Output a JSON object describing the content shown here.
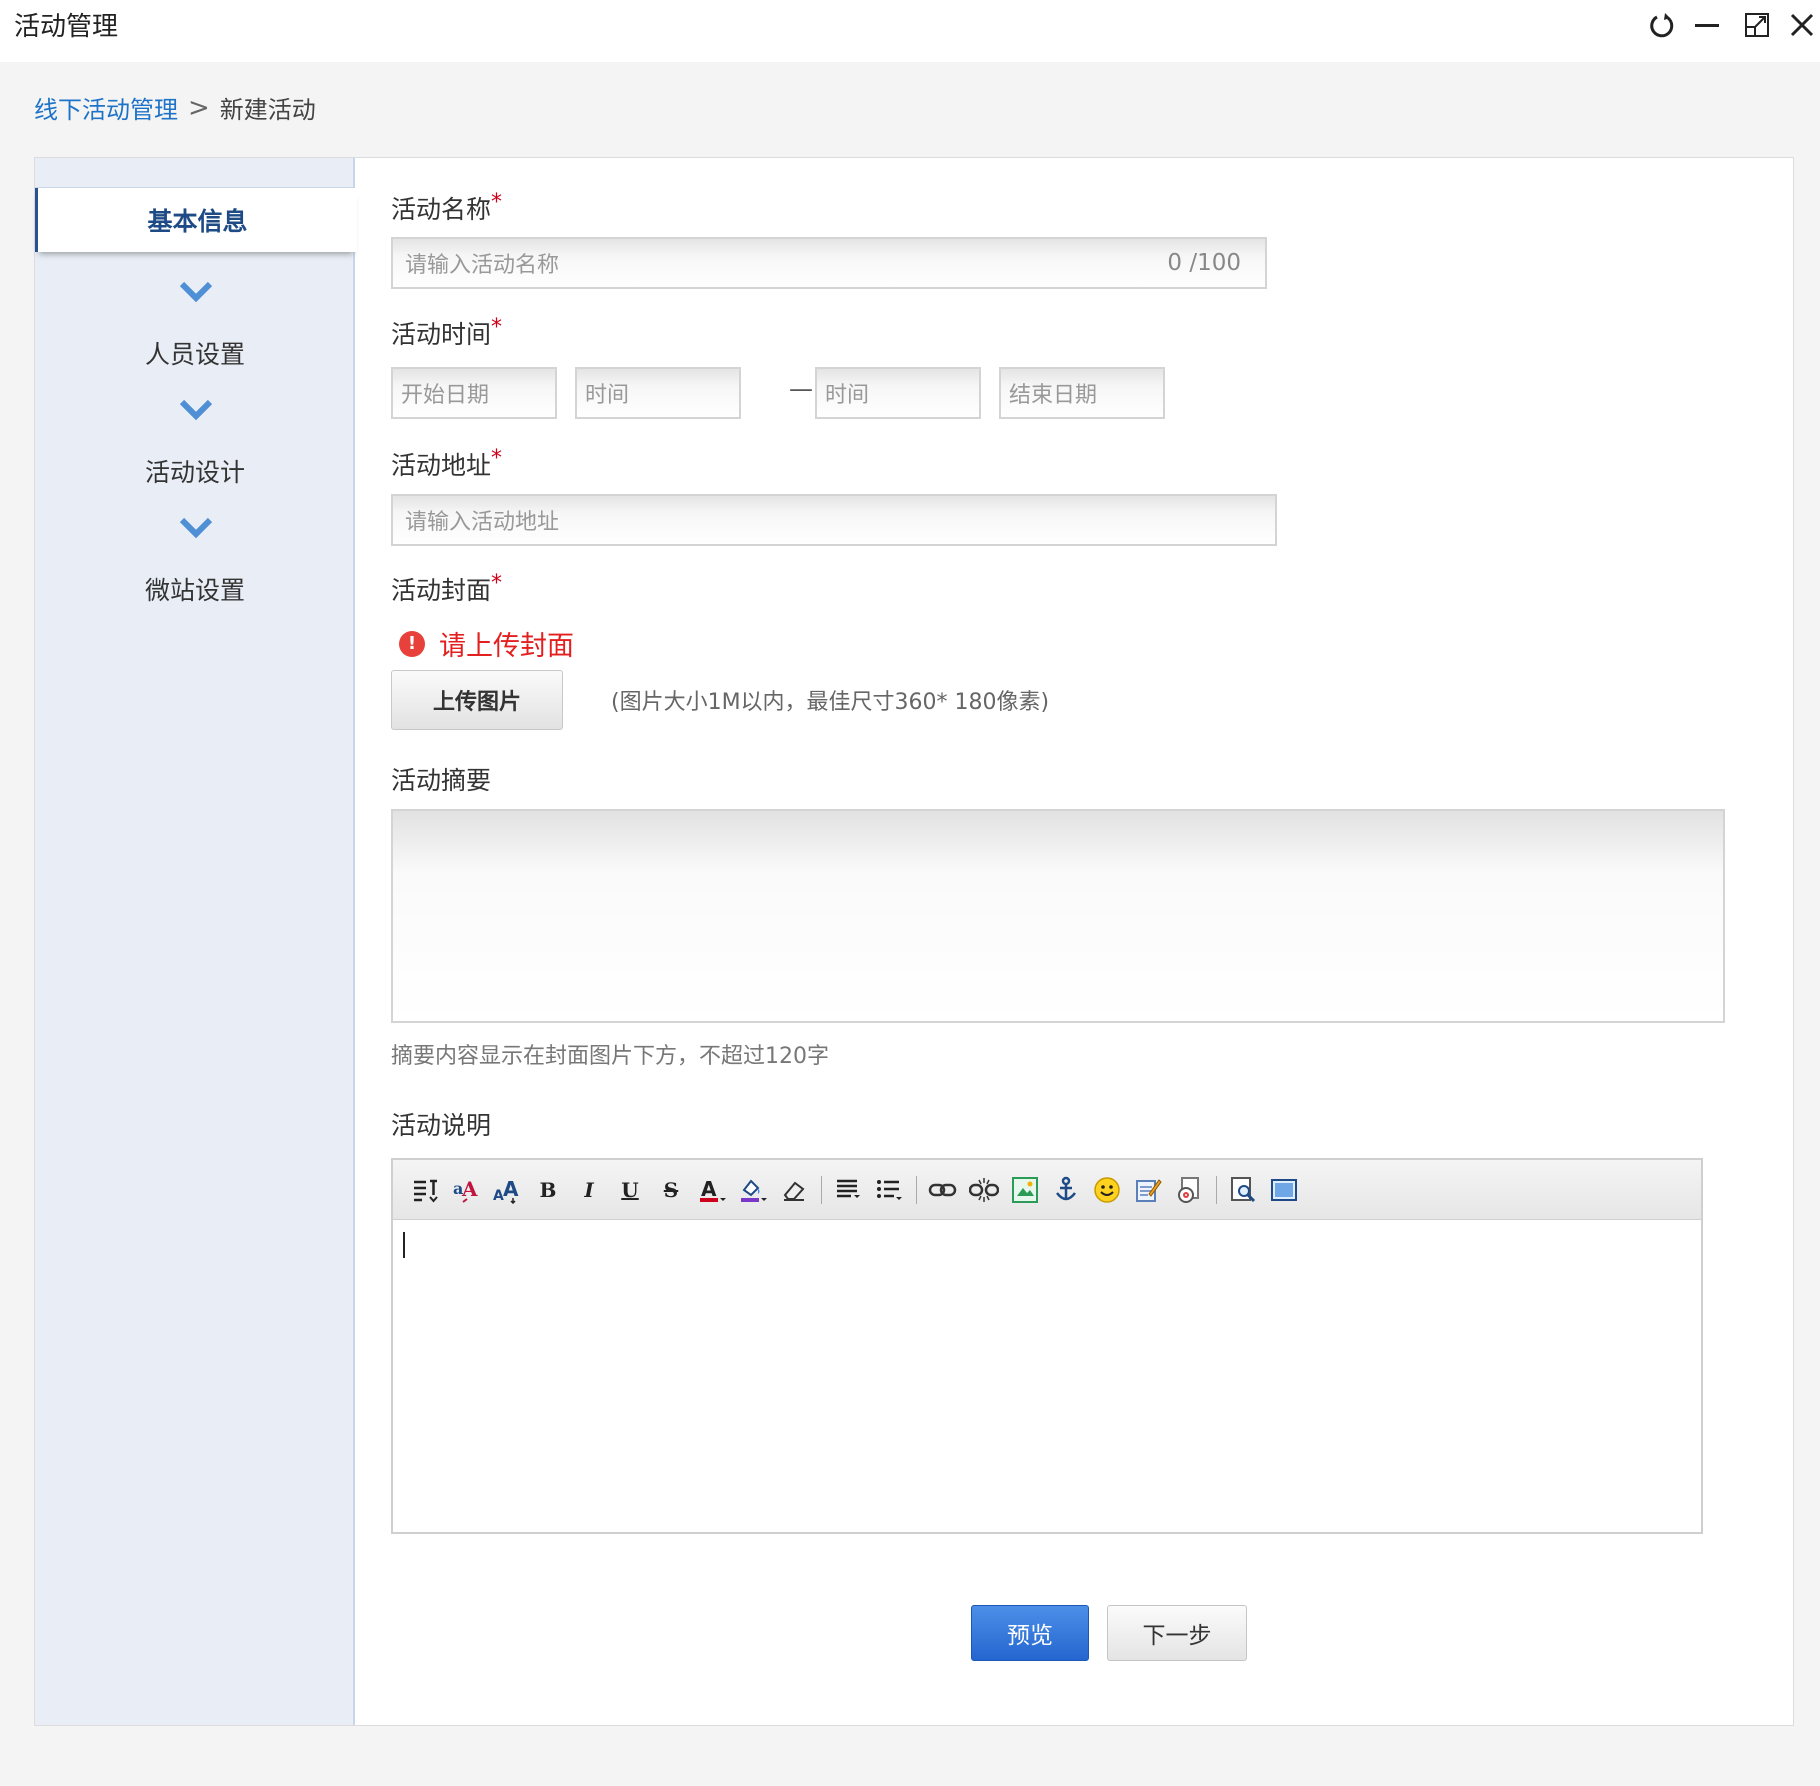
{
  "window": {
    "title": "活动管理",
    "controls": [
      "refresh-icon",
      "minimize-icon",
      "maximize-icon",
      "close-icon"
    ]
  },
  "breadcrumb": {
    "parent": "线下活动管理",
    "separator": ">",
    "current": "新建活动"
  },
  "steps": {
    "active": "基本信息",
    "items": [
      "人员设置",
      "活动设计",
      "微站设置"
    ]
  },
  "form": {
    "name": {
      "label": "活动名称",
      "required": "*",
      "placeholder": "请输入活动名称",
      "counter": "0 /100"
    },
    "time": {
      "label": "活动时间",
      "required": "*",
      "start_date_placeholder": "开始日期",
      "start_time_placeholder": "时间",
      "separator": "—",
      "end_time_placeholder": "时间",
      "end_date_placeholder": "结束日期"
    },
    "address": {
      "label": "活动地址",
      "required": "*",
      "placeholder": "请输入活动地址"
    },
    "cover": {
      "label": "活动封面",
      "required": "*",
      "error": "请上传封面",
      "upload_button": "上传图片",
      "hint": "(图片大小1M以内，最佳尺寸360* 180像素)"
    },
    "summary": {
      "label": "活动摘要",
      "hint": "摘要内容显示在封面图片下方，不超过120字"
    },
    "description": {
      "label": "活动说明",
      "toolbar": [
        "paragraph-format-icon",
        "font-family-icon",
        "font-size-icon",
        "bold-icon",
        "italic-icon",
        "underline-icon",
        "strikethrough-icon",
        "font-color-icon",
        "background-color-icon",
        "eraser-icon",
        "align-icon",
        "list-icon",
        "link-icon",
        "unlink-icon",
        "image-icon",
        "anchor-icon",
        "emoticon-icon",
        "edit-html-icon",
        "media-icon",
        "preview-icon",
        "fullscreen-icon"
      ]
    }
  },
  "actions": {
    "preview": "预览",
    "next": "下一步"
  },
  "colors": {
    "accent": "#1e73c8",
    "active_step": "#1e4b86",
    "error": "#e32020",
    "primary_button": "#2f74d8",
    "sidebar_bg": "#e9eef6"
  }
}
